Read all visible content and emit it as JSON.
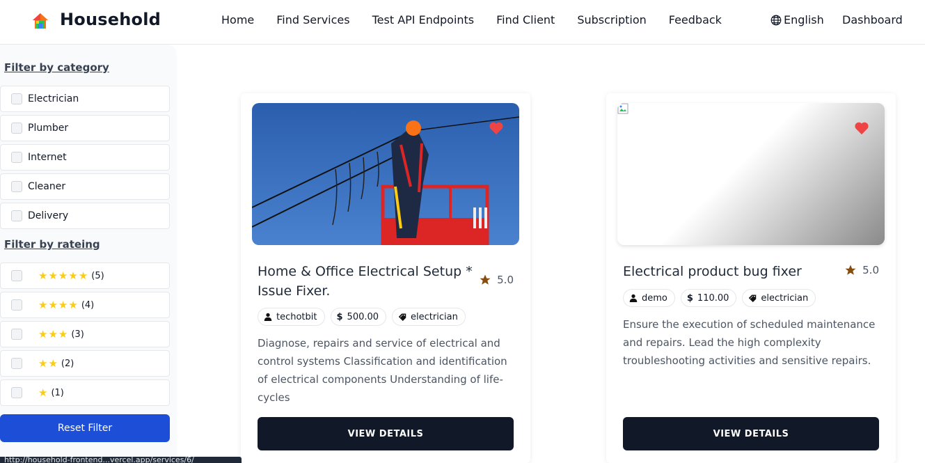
{
  "header": {
    "brand": "Household",
    "nav": [
      "Home",
      "Find Services",
      "Test API Endpoints",
      "Find Client",
      "Subscription",
      "Feedback"
    ],
    "language": "English",
    "dashboard": "Dashboard"
  },
  "sidebar": {
    "category_heading": "Filter by category",
    "categories": [
      "Electrician",
      "Plumber",
      "Internet",
      "Cleaner",
      "Delivery"
    ],
    "rating_heading": "Filter by rateing",
    "ratings": [
      {
        "stars": 5,
        "label": "(5)"
      },
      {
        "stars": 4,
        "label": "(4)"
      },
      {
        "stars": 3,
        "label": "(3)"
      },
      {
        "stars": 2,
        "label": "(2)"
      },
      {
        "stars": 1,
        "label": "(1)"
      }
    ],
    "reset_label": "Reset Filter"
  },
  "status_bar_url": "http://household-frontend...vercel.app/services/6/",
  "cards": [
    {
      "title": "Home & Office Electrical Setup * Issue Fixer.",
      "rating": "5.0",
      "provider": "techotbit",
      "price": "500.00",
      "category": "electrician",
      "description": "Diagnose, repairs and service of electrical and control systems Classification and identification of electrical components Understanding of life-cycles",
      "button": "VIEW DETAILS"
    },
    {
      "title": "Electrical product bug fixer",
      "rating": "5.0",
      "provider": "demo",
      "price": "110.00",
      "category": "electrician",
      "description": "Ensure the execution of scheduled maintenance and repairs. Lead the high complexity troubleshooting activities and sensitive repairs.",
      "button": "VIEW DETAILS"
    }
  ],
  "colors": {
    "primary_button": "#1d4ed8",
    "dark_button": "#111827",
    "heart": "#ef4444",
    "star_yellow": "#facc15",
    "rating_star": "#854d0e"
  }
}
